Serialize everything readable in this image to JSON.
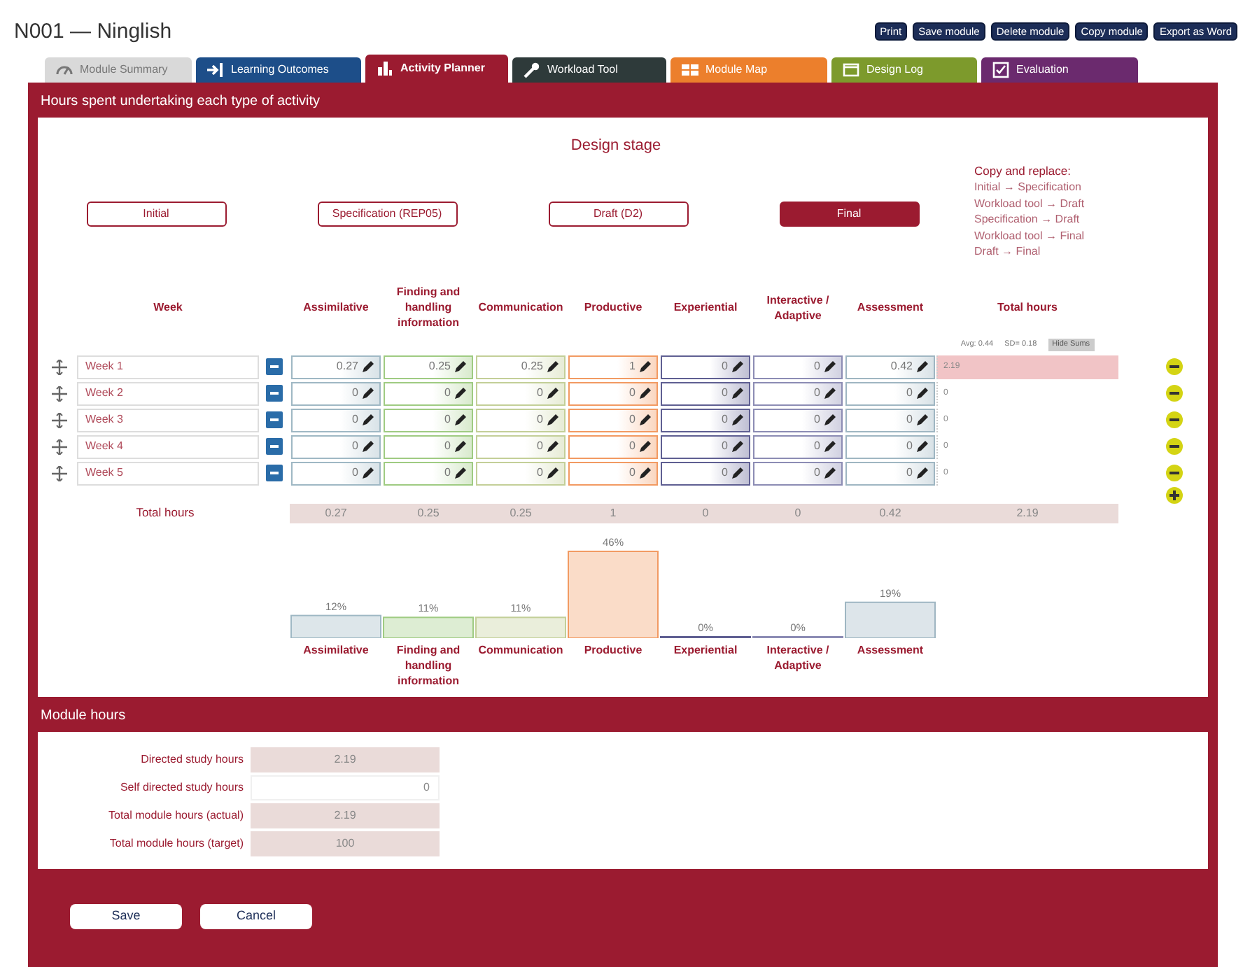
{
  "title": "N001 — Ninglish",
  "actions": [
    "Print",
    "Save module",
    "Delete module",
    "Copy module",
    "Export as Word"
  ],
  "tabs": [
    {
      "label": "Module Summary",
      "color": "#d9d9d9",
      "selected": false
    },
    {
      "label": "Learning Outcomes",
      "color": "#1d4e89",
      "selected": false
    },
    {
      "label": "Activity Planner",
      "color": "#9b1b30",
      "selected": true
    },
    {
      "label": "Workload Tool",
      "color": "#2e3a3a",
      "selected": false
    },
    {
      "label": "Module Map",
      "color": "#ec7f2c",
      "selected": false
    },
    {
      "label": "Design Log",
      "color": "#7d9a2c",
      "selected": false
    },
    {
      "label": "Evaluation",
      "color": "#6b2a6e",
      "selected": false
    }
  ],
  "activity_planner": {
    "heading": "Hours spent undertaking each type of activity",
    "design_stage": {
      "title": "Design stage",
      "stages": [
        {
          "label": "Initial",
          "selected": false
        },
        {
          "label": "Specification (REP05)",
          "selected": false
        },
        {
          "label": "Draft (D2)",
          "selected": false
        },
        {
          "label": "Final",
          "selected": true
        }
      ]
    },
    "copy_replace": {
      "title": "Copy and replace:",
      "lines": [
        "Initial → Specification",
        "Workload tool → Draft",
        "Specification → Draft",
        "Workload tool → Final",
        "Draft → Final"
      ]
    },
    "columns": {
      "week": "Week",
      "total": "Total hours",
      "activities": [
        {
          "name": "Assimilative",
          "color": "#9fb8c4"
        },
        {
          "name": "Finding and handling information",
          "color": "#9fcb82"
        },
        {
          "name": "Communication",
          "color": "#c3cf98"
        },
        {
          "name": "Productive",
          "color": "#f29a62"
        },
        {
          "name": "Experiential",
          "color": "#5f5f92"
        },
        {
          "name": "Interactive / Adaptive",
          "color": "#8c8cb4"
        },
        {
          "name": "Assessment",
          "color": "#9fb6c2"
        }
      ]
    },
    "stats": {
      "average": "Avg: 0.44",
      "deviation": "SD= 0.18",
      "toggle": "Hide Sums"
    },
    "rows": [
      {
        "week": "Week 1",
        "values": [
          "0.27",
          "0.25",
          "0.25",
          "1",
          "0",
          "0",
          "0.42"
        ],
        "total": "2.19",
        "highlighted": true
      },
      {
        "week": "Week 2",
        "values": [
          "0",
          "0",
          "0",
          "0",
          "0",
          "0",
          "0"
        ],
        "total": "0",
        "highlighted": false
      },
      {
        "week": "Week 3",
        "values": [
          "0",
          "0",
          "0",
          "0",
          "0",
          "0",
          "0"
        ],
        "total": "0",
        "highlighted": false
      },
      {
        "week": "Week 4",
        "values": [
          "0",
          "0",
          "0",
          "0",
          "0",
          "0",
          "0"
        ],
        "total": "0",
        "highlighted": false
      },
      {
        "week": "Week 5",
        "values": [
          "0",
          "0",
          "0",
          "0",
          "0",
          "0",
          "0"
        ],
        "total": "0",
        "highlighted": false
      }
    ],
    "totals": {
      "label": "Total hours",
      "values": [
        "0.27",
        "0.25",
        "0.25",
        "1",
        "0",
        "0",
        "0.42"
      ],
      "total": "2.19"
    },
    "chart_data": {
      "type": "bar",
      "categories": [
        "Assimilative",
        "Finding and handling information",
        "Communication",
        "Productive",
        "Experiential",
        "Interactive / Adaptive",
        "Assessment"
      ],
      "values": [
        12,
        11,
        11,
        46,
        0,
        0,
        19
      ],
      "value_labels": [
        "12%",
        "11%",
        "11%",
        "46%",
        "0%",
        "0%",
        "19%"
      ]
    }
  },
  "module_hours": {
    "heading": "Module hours",
    "rows": [
      {
        "label": "Directed study hours",
        "value": "2.19",
        "editable": false
      },
      {
        "label": "Self directed study hours",
        "value": "0",
        "editable": true
      },
      {
        "label": "Total module hours (actual)",
        "value": "2.19",
        "editable": false
      },
      {
        "label": "Total module hours (target)",
        "value": "100",
        "editable": false
      }
    ]
  },
  "buttons": [
    "Save",
    "Cancel"
  ]
}
